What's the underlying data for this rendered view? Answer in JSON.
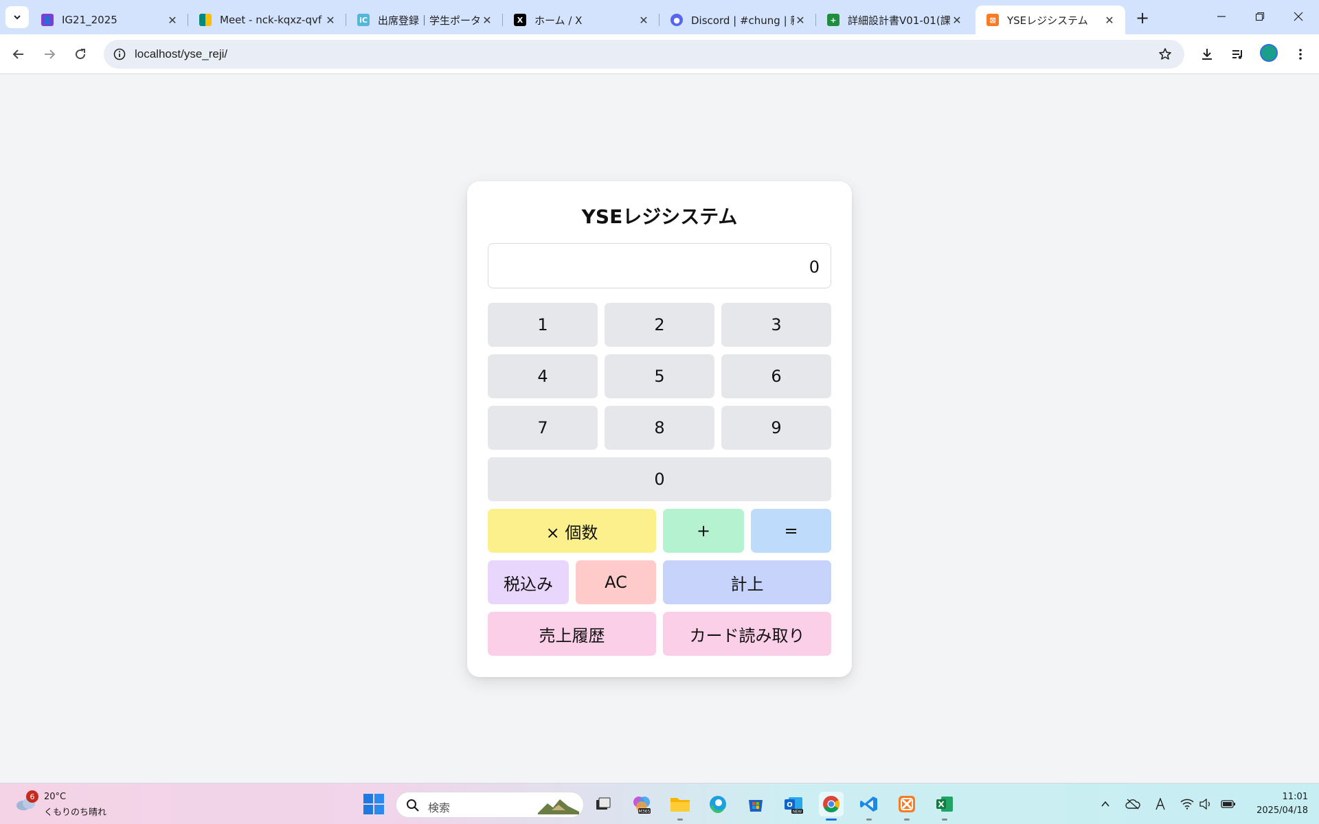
{
  "browser": {
    "tabs": [
      {
        "title": "IG21_2025",
        "favicon": "classroom-icon",
        "color": "#7b3fd6",
        "active": false
      },
      {
        "title": "Meet - nck-kqxz-qvf",
        "favicon": "meet-icon",
        "color": "#00897b",
        "active": false
      },
      {
        "title": "出席登録｜学生ポータ",
        "favicon": "portal-icon",
        "color": "#56b6d8",
        "active": false
      },
      {
        "title": "ホーム / X",
        "favicon": "x-icon",
        "color": "#000000",
        "active": false
      },
      {
        "title": "Discord | #chung | 新",
        "favicon": "discord-icon",
        "color": "#5865f2",
        "active": false
      },
      {
        "title": "詳細設計書V01-01(課",
        "favicon": "sheets-icon",
        "color": "#1e8e3e",
        "active": false
      },
      {
        "title": "YSEレジシステム",
        "favicon": "xampp-icon",
        "color": "#fb7a24",
        "active": true
      }
    ],
    "url": "localhost/yse_reji/"
  },
  "app": {
    "title": "YSEレジシステム",
    "display_value": "0",
    "keys": {
      "k1": "1",
      "k2": "2",
      "k3": "3",
      "k4": "4",
      "k5": "5",
      "k6": "6",
      "k7": "7",
      "k8": "8",
      "k9": "9",
      "k0": "0",
      "multiply": "× 個数",
      "plus": "+",
      "equals": "=",
      "tax": "税込み",
      "clear": "AC",
      "record": "計上",
      "history": "売上履歴",
      "card": "カード読み取り"
    },
    "colors": {
      "number": "#e5e7eb",
      "multiply": "#fbf08c",
      "plus": "#b5f2cf",
      "equals": "#bedbfc",
      "tax": "#e8d6fc",
      "clear": "#fecaca",
      "record": "#c8d3fc",
      "history_card": "#fbcfe8"
    }
  },
  "taskbar": {
    "weather": {
      "badge": "6",
      "temp": "20°C",
      "condition": "くもりのち晴れ"
    },
    "search_label": "検索",
    "apps": [
      "task-view-icon",
      "m365-copilot-icon",
      "file-explorer-icon",
      "edge-icon",
      "microsoft-store-icon",
      "outlook-new-icon",
      "chrome-icon",
      "vscode-icon",
      "xampp-icon",
      "excel-icon"
    ],
    "time": "11:01",
    "date": "2025/04/18"
  }
}
